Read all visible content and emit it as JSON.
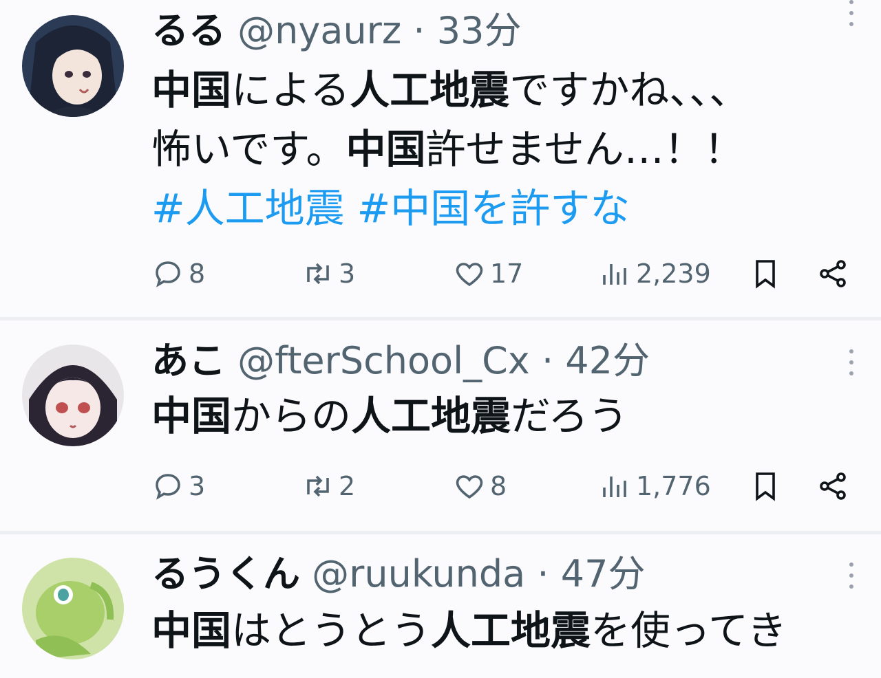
{
  "tweets": [
    {
      "name": "るる",
      "handle": "@nyaurz",
      "time": "33分",
      "text_parts": {
        "p1": "中国",
        "p2": "による",
        "p3": "人工地震",
        "p4": "ですかね、、、",
        "p5": "怖いです。",
        "p6": "中国",
        "p7": "許せません…！！"
      },
      "hashtags": [
        "#人工地震",
        "#中国を許すな"
      ],
      "replies": "8",
      "retweets": "3",
      "likes": "17",
      "views": "2,239"
    },
    {
      "name": "あこ",
      "handle": "@fterSchool_Cx",
      "time": "42分",
      "text_parts": {
        "p1": "中国",
        "p2": "からの",
        "p3": "人工地震",
        "p4": "だろう"
      },
      "replies": "3",
      "retweets": "2",
      "likes": "8",
      "views": "1,776"
    },
    {
      "name": "るうくん",
      "handle": "@ruukunda",
      "time": "47分",
      "text_parts": {
        "p1": "中国",
        "p2": "はとうとう",
        "p3": "人工地震",
        "p4": "を使ってき"
      }
    }
  ],
  "separator": "·",
  "icons": {
    "more": "more-vertical-icon",
    "reply": "reply-icon",
    "retweet": "retweet-icon",
    "like": "heart-icon",
    "views": "views-icon",
    "bookmark": "bookmark-icon",
    "share": "share-icon"
  },
  "colors": {
    "hashtag": "#1d9bf0",
    "muted": "#536471",
    "text": "#0f1419"
  }
}
